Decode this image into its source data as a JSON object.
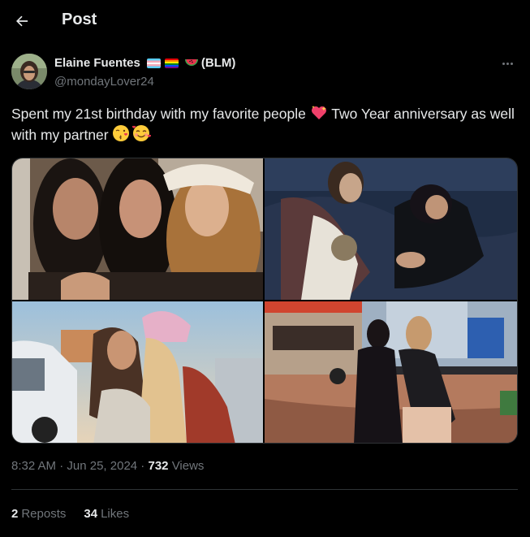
{
  "header": {
    "title": "Post",
    "back_icon": "arrow-left-icon"
  },
  "author": {
    "name": "Elaine Fuentes",
    "name_suffix": "(BLM)",
    "handle": "@mondayLover24",
    "badges": [
      "transgender-flag-icon",
      "rainbow-flag-icon",
      "watermelon-icon"
    ]
  },
  "tweet": {
    "text_before_emoji": "Spent my 21st birthday with my favorite people ",
    "text_after_emoji": " Two Year anniversary as well with my partner ",
    "emojis": [
      "sparkling-heart-icon",
      "kissing-face-icon",
      "smiling-face-with-hearts-icon"
    ]
  },
  "media": {
    "photos": [
      "photo-booth-three-friends",
      "friends-lying-on-rug",
      "beach-kiss-photo",
      "pier-night-photo"
    ]
  },
  "meta": {
    "time": "8:32 AM",
    "sep1": " · ",
    "date": "Jun 25, 2024",
    "sep2": " · ",
    "views_count": "732",
    "views_label": "Views"
  },
  "stats": {
    "reposts_count": "2",
    "reposts_label": "Reposts",
    "likes_count": "34",
    "likes_label": "Likes"
  },
  "colors": {
    "background": "#000000",
    "text": "#e7e9ea",
    "muted": "#71767b",
    "divider": "#2f3336"
  }
}
